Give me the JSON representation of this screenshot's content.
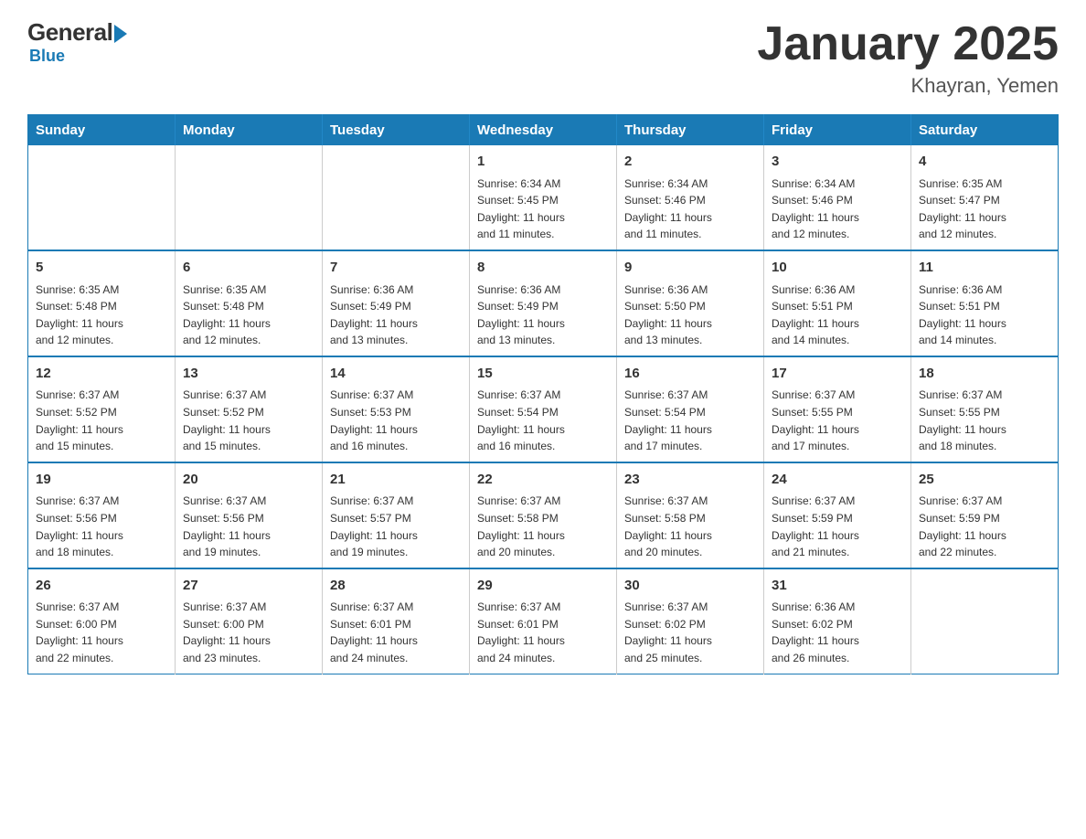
{
  "logo": {
    "general": "General",
    "blue": "Blue"
  },
  "title": "January 2025",
  "subtitle": "Khayran, Yemen",
  "days_of_week": [
    "Sunday",
    "Monday",
    "Tuesday",
    "Wednesday",
    "Thursday",
    "Friday",
    "Saturday"
  ],
  "weeks": [
    [
      {
        "day": "",
        "info": ""
      },
      {
        "day": "",
        "info": ""
      },
      {
        "day": "",
        "info": ""
      },
      {
        "day": "1",
        "info": "Sunrise: 6:34 AM\nSunset: 5:45 PM\nDaylight: 11 hours\nand 11 minutes."
      },
      {
        "day": "2",
        "info": "Sunrise: 6:34 AM\nSunset: 5:46 PM\nDaylight: 11 hours\nand 11 minutes."
      },
      {
        "day": "3",
        "info": "Sunrise: 6:34 AM\nSunset: 5:46 PM\nDaylight: 11 hours\nand 12 minutes."
      },
      {
        "day": "4",
        "info": "Sunrise: 6:35 AM\nSunset: 5:47 PM\nDaylight: 11 hours\nand 12 minutes."
      }
    ],
    [
      {
        "day": "5",
        "info": "Sunrise: 6:35 AM\nSunset: 5:48 PM\nDaylight: 11 hours\nand 12 minutes."
      },
      {
        "day": "6",
        "info": "Sunrise: 6:35 AM\nSunset: 5:48 PM\nDaylight: 11 hours\nand 12 minutes."
      },
      {
        "day": "7",
        "info": "Sunrise: 6:36 AM\nSunset: 5:49 PM\nDaylight: 11 hours\nand 13 minutes."
      },
      {
        "day": "8",
        "info": "Sunrise: 6:36 AM\nSunset: 5:49 PM\nDaylight: 11 hours\nand 13 minutes."
      },
      {
        "day": "9",
        "info": "Sunrise: 6:36 AM\nSunset: 5:50 PM\nDaylight: 11 hours\nand 13 minutes."
      },
      {
        "day": "10",
        "info": "Sunrise: 6:36 AM\nSunset: 5:51 PM\nDaylight: 11 hours\nand 14 minutes."
      },
      {
        "day": "11",
        "info": "Sunrise: 6:36 AM\nSunset: 5:51 PM\nDaylight: 11 hours\nand 14 minutes."
      }
    ],
    [
      {
        "day": "12",
        "info": "Sunrise: 6:37 AM\nSunset: 5:52 PM\nDaylight: 11 hours\nand 15 minutes."
      },
      {
        "day": "13",
        "info": "Sunrise: 6:37 AM\nSunset: 5:52 PM\nDaylight: 11 hours\nand 15 minutes."
      },
      {
        "day": "14",
        "info": "Sunrise: 6:37 AM\nSunset: 5:53 PM\nDaylight: 11 hours\nand 16 minutes."
      },
      {
        "day": "15",
        "info": "Sunrise: 6:37 AM\nSunset: 5:54 PM\nDaylight: 11 hours\nand 16 minutes."
      },
      {
        "day": "16",
        "info": "Sunrise: 6:37 AM\nSunset: 5:54 PM\nDaylight: 11 hours\nand 17 minutes."
      },
      {
        "day": "17",
        "info": "Sunrise: 6:37 AM\nSunset: 5:55 PM\nDaylight: 11 hours\nand 17 minutes."
      },
      {
        "day": "18",
        "info": "Sunrise: 6:37 AM\nSunset: 5:55 PM\nDaylight: 11 hours\nand 18 minutes."
      }
    ],
    [
      {
        "day": "19",
        "info": "Sunrise: 6:37 AM\nSunset: 5:56 PM\nDaylight: 11 hours\nand 18 minutes."
      },
      {
        "day": "20",
        "info": "Sunrise: 6:37 AM\nSunset: 5:56 PM\nDaylight: 11 hours\nand 19 minutes."
      },
      {
        "day": "21",
        "info": "Sunrise: 6:37 AM\nSunset: 5:57 PM\nDaylight: 11 hours\nand 19 minutes."
      },
      {
        "day": "22",
        "info": "Sunrise: 6:37 AM\nSunset: 5:58 PM\nDaylight: 11 hours\nand 20 minutes."
      },
      {
        "day": "23",
        "info": "Sunrise: 6:37 AM\nSunset: 5:58 PM\nDaylight: 11 hours\nand 20 minutes."
      },
      {
        "day": "24",
        "info": "Sunrise: 6:37 AM\nSunset: 5:59 PM\nDaylight: 11 hours\nand 21 minutes."
      },
      {
        "day": "25",
        "info": "Sunrise: 6:37 AM\nSunset: 5:59 PM\nDaylight: 11 hours\nand 22 minutes."
      }
    ],
    [
      {
        "day": "26",
        "info": "Sunrise: 6:37 AM\nSunset: 6:00 PM\nDaylight: 11 hours\nand 22 minutes."
      },
      {
        "day": "27",
        "info": "Sunrise: 6:37 AM\nSunset: 6:00 PM\nDaylight: 11 hours\nand 23 minutes."
      },
      {
        "day": "28",
        "info": "Sunrise: 6:37 AM\nSunset: 6:01 PM\nDaylight: 11 hours\nand 24 minutes."
      },
      {
        "day": "29",
        "info": "Sunrise: 6:37 AM\nSunset: 6:01 PM\nDaylight: 11 hours\nand 24 minutes."
      },
      {
        "day": "30",
        "info": "Sunrise: 6:37 AM\nSunset: 6:02 PM\nDaylight: 11 hours\nand 25 minutes."
      },
      {
        "day": "31",
        "info": "Sunrise: 6:36 AM\nSunset: 6:02 PM\nDaylight: 11 hours\nand 26 minutes."
      },
      {
        "day": "",
        "info": ""
      }
    ]
  ]
}
